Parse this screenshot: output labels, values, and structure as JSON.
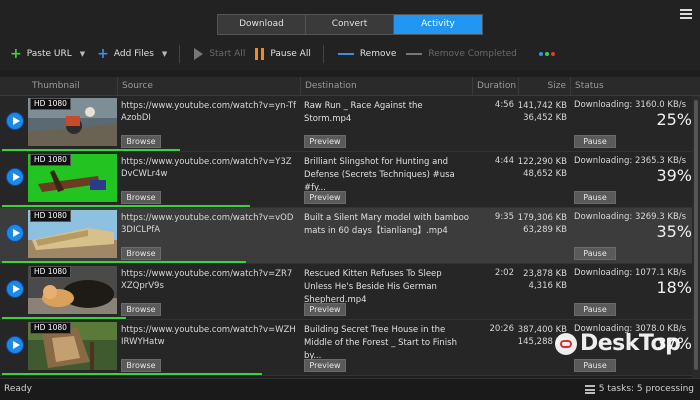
{
  "tabs": [
    {
      "label": "Download",
      "active": false
    },
    {
      "label": "Convert",
      "active": false
    },
    {
      "label": "Activity",
      "active": true
    }
  ],
  "toolbar": {
    "paste_url": "Paste URL",
    "add_files": "Add Files",
    "start_all": "Start All",
    "pause_all": "Pause All",
    "remove": "Remove",
    "remove_completed": "Remove Completed"
  },
  "columns": {
    "thumbnail": "Thumbnail",
    "source": "Source",
    "destination": "Destination",
    "duration": "Duration",
    "size": "Size",
    "status": "Status"
  },
  "buttons": {
    "browse": "Browse",
    "preview": "Preview",
    "pause": "Pause"
  },
  "rows": [
    {
      "quality": "HD 1080",
      "source": "https://www.youtube.com/watch?v=yn-TfAzobDI",
      "destination": "Raw Run _ Race Against the Storm.mp4",
      "duration": "4:56",
      "size_total": "141,742 KB",
      "size_done": "36,452 KB",
      "status": "Downloading: 3160.0 KB/s",
      "percent": "25%",
      "progress": 0.25,
      "selected": false
    },
    {
      "quality": "HD 1080",
      "source": "https://www.youtube.com/watch?v=Y3ZDvCWLr4w",
      "destination": "Brilliant Slingshot for Hunting and Defense (Secrets Techniques) #usa #fy...",
      "duration": "4:44",
      "size_total": "122,290 KB",
      "size_done": "48,652 KB",
      "status": "Downloading: 2365.3 KB/s",
      "percent": "39%",
      "progress": 0.39,
      "selected": false
    },
    {
      "quality": "HD 1080",
      "source": "https://www.youtube.com/watch?v=vOD3DICLPfA",
      "destination": "Built a Silent Mary model with bamboo mats in 60 days【tianliang】.mp4",
      "duration": "9:35",
      "size_total": "179,306 KB",
      "size_done": "63,289 KB",
      "status": "Downloading: 3269.3 KB/s",
      "percent": "35%",
      "progress": 0.35,
      "selected": true
    },
    {
      "quality": "HD 1080",
      "source": "https://www.youtube.com/watch?v=ZR7XZQprV9s",
      "destination": "Rescued Kitten Refuses To Sleep Unless He's Beside His German Shepherd.mp4",
      "duration": "2:02",
      "size_total": "23,878 KB",
      "size_done": "4,316 KB",
      "status": "Downloading: 1077.1 KB/s",
      "percent": "18%",
      "progress": 0.18,
      "selected": false
    },
    {
      "quality": "HD 1080",
      "source": "https://www.youtube.com/watch?v=WZHIRWYHatw",
      "destination": "Building Secret Tree House in the Middle of the Forest _ Start to Finish by...",
      "duration": "20:26",
      "size_total": "387,400 KB",
      "size_done": "145,288 KB",
      "status": "Downloading: 3078.0 KB/s",
      "percent": "37%",
      "progress": 0.37,
      "selected": false
    }
  ],
  "statusbar": {
    "ready": "Ready",
    "tasks": "5 tasks: 5 processing"
  },
  "watermark": "DeskTop",
  "colors": {
    "accent": "#2196f3",
    "progress": "#3dd13d",
    "pause": "#f08a24"
  }
}
